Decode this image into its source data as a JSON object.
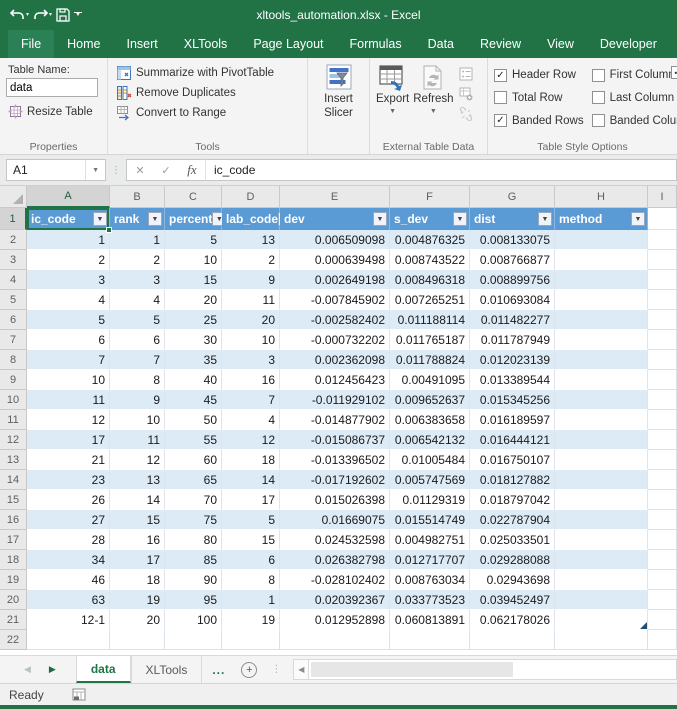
{
  "title_bar": {
    "title": "xltools_automation.xlsx - Excel"
  },
  "ribbon_tabs": [
    "File",
    "Home",
    "Insert",
    "XLTools",
    "Page Layout",
    "Formulas",
    "Data",
    "Review",
    "View",
    "Developer"
  ],
  "ribbon": {
    "properties": {
      "table_name_label": "Table Name:",
      "table_name_value": "data",
      "resize_table_label": "Resize Table",
      "group_label": "Properties"
    },
    "tools": {
      "summarize_label": "Summarize with PivotTable",
      "remove_duplicates_label": "Remove Duplicates",
      "convert_label": "Convert to Range",
      "group_label": "Tools"
    },
    "slicer": {
      "label": "Insert Slicer"
    },
    "external": {
      "export_label": "Export",
      "refresh_label": "Refresh",
      "group_label": "External Table Data"
    },
    "style_options": {
      "group_label": "Table Style Options",
      "checkboxes": [
        {
          "label": "Header Row",
          "checked": true
        },
        {
          "label": "Total Row",
          "checked": false
        },
        {
          "label": "Banded Rows",
          "checked": true
        },
        {
          "label": "First Column",
          "checked": false
        },
        {
          "label": "Last Column",
          "checked": false
        },
        {
          "label": "Banded Columns",
          "checked": false
        }
      ],
      "partial_checkbox_checked": true
    }
  },
  "formula_bar": {
    "name_box": "A1",
    "fx_label": "fx",
    "content": "ic_code"
  },
  "sheet": {
    "column_letters": [
      "A",
      "B",
      "C",
      "D",
      "E",
      "F",
      "G",
      "H",
      "I"
    ],
    "selected_cell": "A1",
    "selected_column": "A",
    "selected_row": "1",
    "table_headers": [
      "ic_code",
      "rank",
      "percent",
      "lab_code",
      "dev",
      "s_dev",
      "dist",
      "method"
    ],
    "rows": [
      [
        "1",
        "1",
        "5",
        "13",
        "0.006509098",
        "0.004876325",
        "0.008133075",
        ""
      ],
      [
        "2",
        "2",
        "10",
        "2",
        "0.000639498",
        "0.008743522",
        "0.008766877",
        ""
      ],
      [
        "3",
        "3",
        "15",
        "9",
        "0.002649198",
        "0.008496318",
        "0.008899756",
        ""
      ],
      [
        "4",
        "4",
        "20",
        "11",
        "-0.007845902",
        "0.007265251",
        "0.010693084",
        ""
      ],
      [
        "5",
        "5",
        "25",
        "20",
        "-0.002582402",
        "0.011188114",
        "0.011482277",
        ""
      ],
      [
        "6",
        "6",
        "30",
        "10",
        "-0.000732202",
        "0.011765187",
        "0.011787949",
        ""
      ],
      [
        "7",
        "7",
        "35",
        "3",
        "0.002362098",
        "0.011788824",
        "0.012023139",
        ""
      ],
      [
        "10",
        "8",
        "40",
        "16",
        "0.012456423",
        "0.00491095",
        "0.013389544",
        ""
      ],
      [
        "11",
        "9",
        "45",
        "7",
        "-0.011929102",
        "0.009652637",
        "0.015345256",
        ""
      ],
      [
        "12",
        "10",
        "50",
        "4",
        "-0.014877902",
        "0.006383658",
        "0.016189597",
        ""
      ],
      [
        "17",
        "11",
        "55",
        "12",
        "-0.015086737",
        "0.006542132",
        "0.016444121",
        ""
      ],
      [
        "21",
        "12",
        "60",
        "18",
        "-0.013396502",
        "0.01005484",
        "0.016750107",
        ""
      ],
      [
        "23",
        "13",
        "65",
        "14",
        "-0.017192602",
        "0.005747569",
        "0.018127882",
        ""
      ],
      [
        "26",
        "14",
        "70",
        "17",
        "0.015026398",
        "0.01129319",
        "0.018797042",
        ""
      ],
      [
        "27",
        "15",
        "75",
        "5",
        "0.01669075",
        "0.015514749",
        "0.022787904",
        ""
      ],
      [
        "28",
        "16",
        "80",
        "15",
        "0.024532598",
        "0.004982751",
        "0.025033501",
        ""
      ],
      [
        "34",
        "17",
        "85",
        "6",
        "0.026382798",
        "0.012717707",
        "0.029288088",
        ""
      ],
      [
        "46",
        "18",
        "90",
        "8",
        "-0.028102402",
        "0.008763034",
        "0.02943698",
        ""
      ],
      [
        "63",
        "19",
        "95",
        "1",
        "0.020392367",
        "0.033773523",
        "0.039452497",
        ""
      ],
      [
        "12-1",
        "20",
        "100",
        "19",
        "0.012952898",
        "0.060813891",
        "0.062178026",
        ""
      ]
    ],
    "first_data_row_number": 2,
    "last_row_number": 22
  },
  "sheet_tabs": {
    "tabs": [
      {
        "label": "data",
        "active": true
      },
      {
        "label": "XLTools",
        "active": false
      }
    ],
    "more_label": "..."
  },
  "status_bar": {
    "status": "Ready"
  },
  "colors": {
    "excel_green": "#217346",
    "table_header_blue": "#5b9bd5",
    "banded_row_blue": "#ddebf7"
  }
}
